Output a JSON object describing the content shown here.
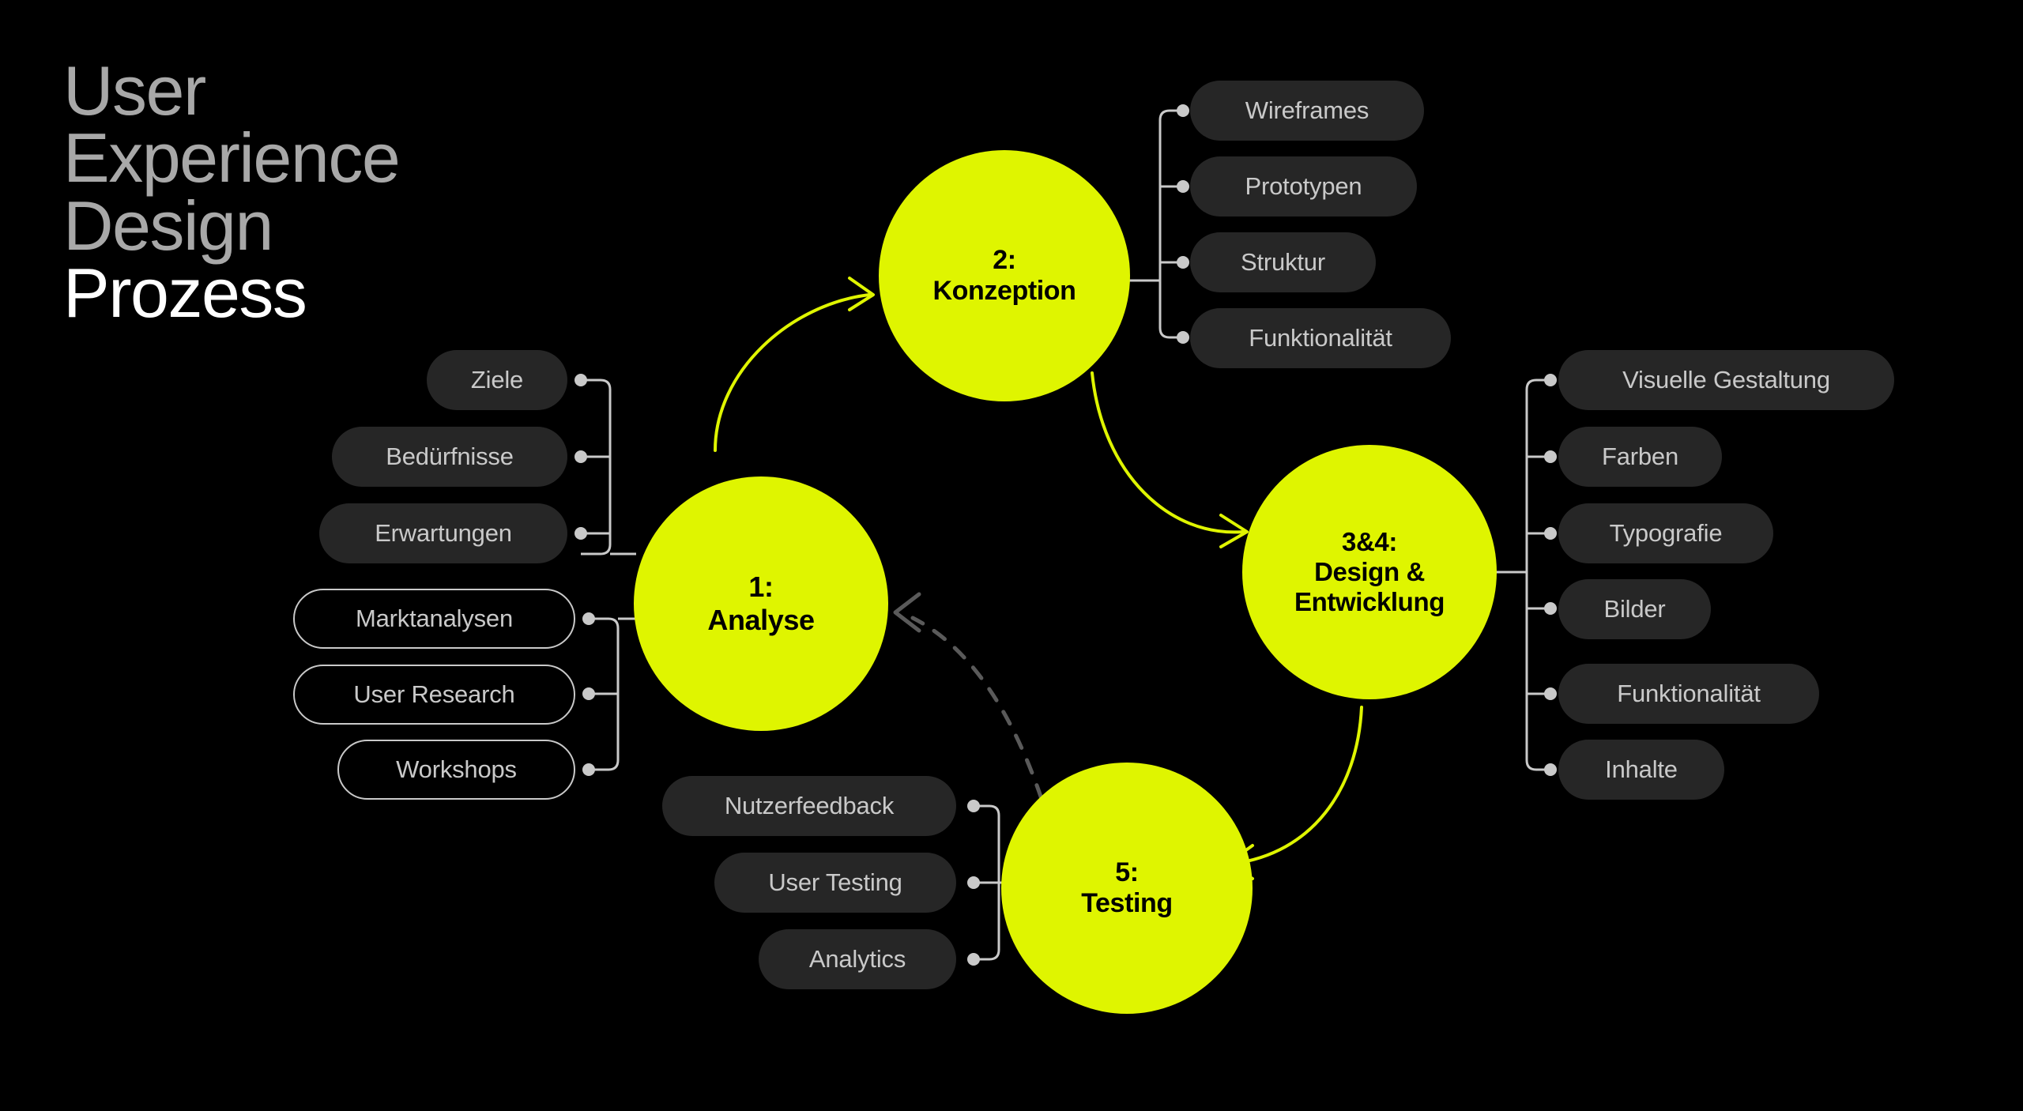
{
  "meta": {
    "background_color": "#000000",
    "accent_color": "#DFF500",
    "pill_fill_color": "#262626",
    "pill_text_color": "#C9C9C9",
    "connector_color": "#C9C9C9",
    "feedback_arrow_color": "#5A5A5A"
  },
  "title": {
    "lines": [
      {
        "text": "User",
        "emphasis": false
      },
      {
        "text": "Experience",
        "emphasis": false
      },
      {
        "text": "Design",
        "emphasis": false
      },
      {
        "text": "Prozess",
        "emphasis": true
      }
    ]
  },
  "stages": [
    {
      "id": "analyse",
      "number": "1:",
      "name": "Analyse",
      "label_lines": [
        "1:",
        "Analyse"
      ],
      "branch_side": "left",
      "items_primary": [
        "Ziele",
        "Bedürfnisse",
        "Erwartungen"
      ],
      "items_secondary": [
        "Marktanalysen",
        "User Research",
        "Workshops"
      ]
    },
    {
      "id": "konzeption",
      "number": "2:",
      "name": "Konzeption",
      "label_lines": [
        "2:",
        "Konzeption"
      ],
      "branch_side": "right",
      "items_primary": [
        "Wireframes",
        "Prototypen",
        "Struktur",
        "Funktionalität"
      ],
      "items_secondary": []
    },
    {
      "id": "design-entwicklung",
      "number": "3&4:",
      "name": "Design & Entwicklung",
      "label_lines": [
        "3&4:",
        "Design &",
        "Entwicklung"
      ],
      "branch_side": "right",
      "items_primary": [
        "Visuelle Gestaltung",
        "Farben",
        "Typografie",
        "Bilder",
        "Funktionalität",
        "Inhalte"
      ],
      "items_secondary": []
    },
    {
      "id": "testing",
      "number": "5:",
      "name": "Testing",
      "label_lines": [
        "5:",
        "Testing"
      ],
      "branch_side": "left",
      "items_primary": [
        "Nutzerfeedback",
        "User Testing",
        "Analytics"
      ],
      "items_secondary": []
    }
  ],
  "flow_arrows": [
    {
      "from": "analyse",
      "to": "konzeption",
      "style": "solid",
      "color": "#DFF500"
    },
    {
      "from": "konzeption",
      "to": "design-entwicklung",
      "style": "solid",
      "color": "#DFF500"
    },
    {
      "from": "design-entwicklung",
      "to": "testing",
      "style": "solid",
      "color": "#DFF500"
    },
    {
      "from": "testing",
      "to": "analyse",
      "style": "dashed",
      "color": "#5A5A5A"
    }
  ],
  "circle_labels": {
    "analyse_l1": "1:",
    "analyse_l2": "Analyse",
    "konzeption_l1": "2:",
    "konzeption_l2": "Konzeption",
    "design_l1": "3&4:",
    "design_l2": "Design &",
    "design_l3": "Entwicklung",
    "testing_l1": "5:",
    "testing_l2": "Testing"
  },
  "pills": {
    "analyse": {
      "p0": "Ziele",
      "p1": "Bedürfnisse",
      "p2": "Erwartungen",
      "s0": "Marktanalysen",
      "s1": "User Research",
      "s2": "Workshops"
    },
    "konzeption": {
      "p0": "Wireframes",
      "p1": "Prototypen",
      "p2": "Struktur",
      "p3": "Funktionalität"
    },
    "design": {
      "p0": "Visuelle Gestaltung",
      "p1": "Farben",
      "p2": "Typografie",
      "p3": "Bilder",
      "p4": "Funktionalität",
      "p5": "Inhalte"
    },
    "testing": {
      "p0": "Nutzerfeedback",
      "p1": "User Testing",
      "p2": "Analytics"
    }
  }
}
